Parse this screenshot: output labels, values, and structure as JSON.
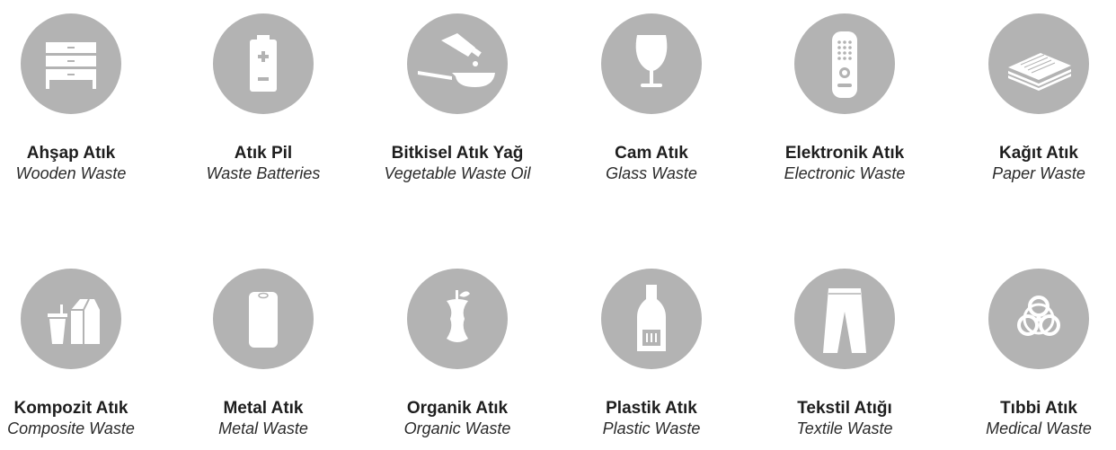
{
  "colors": {
    "circle": "#b3b3b3",
    "icon": "#ffffff",
    "text": "#1e1e1e"
  },
  "categories": [
    {
      "tr": "Ahşap Atık",
      "en": "Wooden Waste",
      "icon": "drawer-cabinet-icon"
    },
    {
      "tr": "Atık Pil",
      "en": "Waste Batteries",
      "icon": "battery-icon"
    },
    {
      "tr": "Bitkisel Atık Yağ",
      "en": "Vegetable Waste Oil",
      "icon": "oil-pan-icon"
    },
    {
      "tr": "Cam Atık",
      "en": "Glass Waste",
      "icon": "wine-glass-icon"
    },
    {
      "tr": "Elektronik Atık",
      "en": "Electronic Waste",
      "icon": "remote-control-icon"
    },
    {
      "tr": "Kağıt Atık",
      "en": "Paper Waste",
      "icon": "paper-stack-icon"
    },
    {
      "tr": "Kompozit Atık",
      "en": "Composite Waste",
      "icon": "drink-carton-icon"
    },
    {
      "tr": "Metal Atık",
      "en": "Metal Waste",
      "icon": "can-icon"
    },
    {
      "tr": "Organik Atık",
      "en": "Organic Waste",
      "icon": "apple-core-icon"
    },
    {
      "tr": "Plastik Atık",
      "en": "Plastic Waste",
      "icon": "plastic-bottle-icon"
    },
    {
      "tr": "Tekstil Atığı",
      "en": "Textile Waste",
      "icon": "pants-icon"
    },
    {
      "tr": "Tıbbi Atık",
      "en": "Medical Waste",
      "icon": "biohazard-icon"
    }
  ]
}
